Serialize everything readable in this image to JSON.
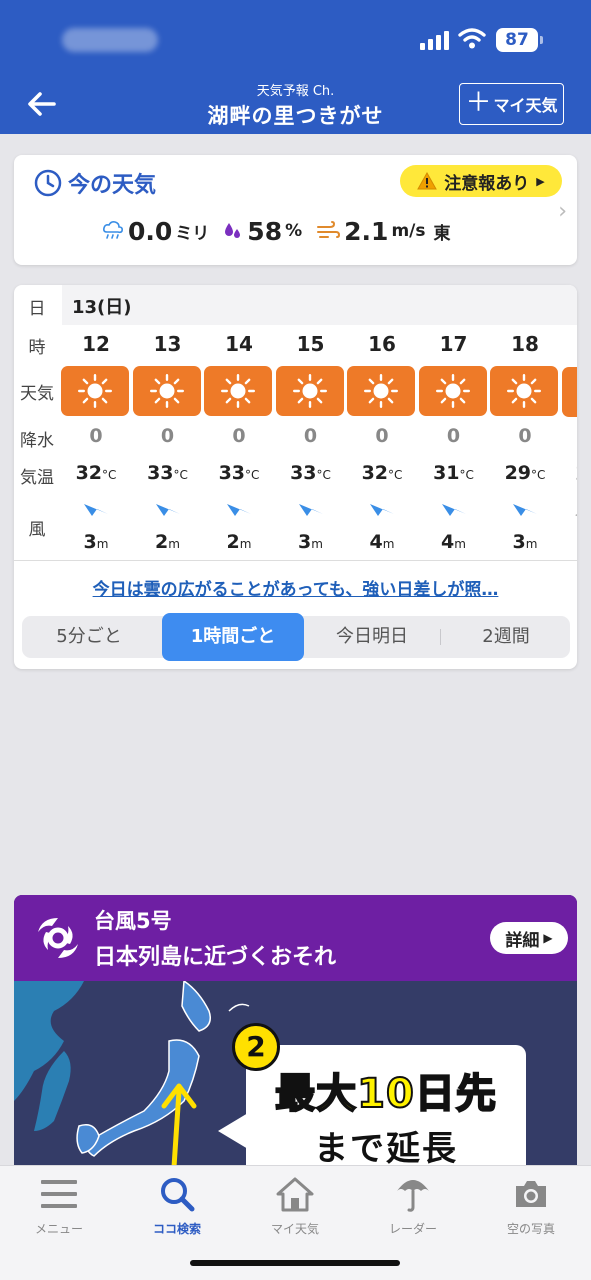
{
  "status": {
    "battery": "87"
  },
  "header": {
    "subtitle": "天気予報 Ch.",
    "title": "湖畔の里つきがせ",
    "my_weather_label": "マイ天気"
  },
  "now": {
    "title": "今の天気",
    "alert_label": "注意報あり",
    "precip_value": "0.0",
    "precip_unit": "ミリ",
    "humidity_value": "58",
    "humidity_unit": "%",
    "wind_value": "2.1",
    "wind_unit": "m/s",
    "wind_dir": "東"
  },
  "forecast": {
    "labels": {
      "day": "日",
      "hour": "時",
      "weather": "天気",
      "precip": "降水",
      "temp": "気温",
      "wind": "風"
    },
    "date": "13(日)",
    "temp_unit": "°C",
    "wind_unit": "m",
    "hours": [
      {
        "hour": "12",
        "icon": "sun-icon",
        "precip": "0",
        "temp": "32",
        "wind": "3"
      },
      {
        "hour": "13",
        "icon": "sun-icon",
        "precip": "0",
        "temp": "33",
        "wind": "2"
      },
      {
        "hour": "14",
        "icon": "sun-icon",
        "precip": "0",
        "temp": "33",
        "wind": "2"
      },
      {
        "hour": "15",
        "icon": "sun-icon",
        "precip": "0",
        "temp": "33",
        "wind": "3"
      },
      {
        "hour": "16",
        "icon": "sun-icon",
        "precip": "0",
        "temp": "32",
        "wind": "4"
      },
      {
        "hour": "17",
        "icon": "sun-icon",
        "precip": "0",
        "temp": "31",
        "wind": "4"
      },
      {
        "hour": "18",
        "icon": "sun-icon",
        "precip": "0",
        "temp": "29",
        "wind": "3"
      }
    ],
    "summary": "今日は雲の広がることがあっても、強い日差しが照…",
    "tabs": [
      "5分ごと",
      "1時間ごと",
      "今日明日",
      "2週間"
    ],
    "active_tab": 1
  },
  "typhoon": {
    "title1": "台風5号",
    "title2": "日本列島に近づくおそれ",
    "detail_label": "詳細",
    "badge_number": "2",
    "headline1": "最大10日先",
    "headline2": "まで延長"
  },
  "tabbar": {
    "items": [
      {
        "label": "メニュー",
        "icon": "menu-icon"
      },
      {
        "label": "ココ検索",
        "icon": "search-icon"
      },
      {
        "label": "マイ天気",
        "icon": "home-icon"
      },
      {
        "label": "レーダー",
        "icon": "umbrella-icon"
      },
      {
        "label": "空の写真",
        "icon": "camera-icon"
      }
    ],
    "active": 1
  },
  "colors": {
    "header_blue": "#2d5cc3",
    "sun_orange": "#ee7a28",
    "alert_yellow": "#ffe83a",
    "typhoon_purple": "#6e1fa3",
    "link_blue": "#1f5fb9",
    "active_tab_blue": "#3e8cf0"
  }
}
